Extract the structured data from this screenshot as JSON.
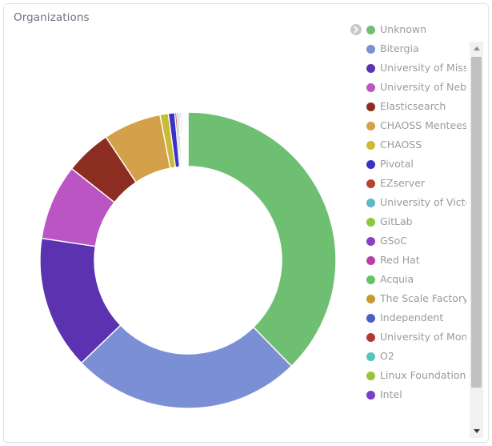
{
  "panel": {
    "title": "Organizations"
  },
  "legend": {
    "cursor_icon": "chevron-right-circle-icon",
    "items": [
      {
        "label": "Unknown",
        "color": "#6fbf73"
      },
      {
        "label": "Bitergia",
        "color": "#7b8fd4"
      },
      {
        "label": "University of Miss...",
        "color": "#5b33b0"
      },
      {
        "label": "University of Nebr...",
        "color": "#bb55c4"
      },
      {
        "label": "Elasticsearch",
        "color": "#8c2d22"
      },
      {
        "label": "CHAOSS Mentees",
        "color": "#d4a04a"
      },
      {
        "label": "CHAOSS",
        "color": "#c9bb36"
      },
      {
        "label": "Pivotal",
        "color": "#3a32c4"
      },
      {
        "label": "EZserver",
        "color": "#b3462f"
      },
      {
        "label": "University of Victoria",
        "color": "#5fb6c4"
      },
      {
        "label": "GitLab",
        "color": "#8dc63f"
      },
      {
        "label": "GSoC",
        "color": "#8a3fc0"
      },
      {
        "label": "Red Hat",
        "color": "#b83fa8"
      },
      {
        "label": "Acquia",
        "color": "#63c463"
      },
      {
        "label": "The Scale Factory",
        "color": "#c8992f"
      },
      {
        "label": "Independent",
        "color": "#4a5fc1"
      },
      {
        "label": "University of Mons",
        "color": "#b03a3a"
      },
      {
        "label": "O2",
        "color": "#55c4bb"
      },
      {
        "label": "Linux Foundation",
        "color": "#9ac43f"
      },
      {
        "label": "Intel",
        "color": "#7a3fc8"
      }
    ]
  },
  "scrollbar": {
    "up_icon": "triangle-up-icon",
    "down_icon": "triangle-down-icon"
  },
  "chart_data": {
    "type": "pie",
    "title": "Organizations",
    "variant": "donut",
    "center": [
      230,
      290
    ],
    "outer_radius": 185,
    "inner_radius": 117,
    "start_angle": 0,
    "legend_position": "right",
    "grid": false,
    "categories": [
      "Unknown",
      "Bitergia",
      "University of Miss...",
      "University of Nebr...",
      "Elasticsearch",
      "CHAOSS Mentees",
      "CHAOSS",
      "Pivotal",
      "EZserver",
      "University of Victoria",
      "GitLab",
      "GSoC",
      "Red Hat",
      "Acquia",
      "The Scale Factory",
      "Independent",
      "University of Mons",
      "O2",
      "Linux Foundation",
      "Intel"
    ],
    "values": [
      37.5,
      25.0,
      14.5,
      8.2,
      5.0,
      6.3,
      0.9,
      0.7,
      0.2,
      0.2,
      0.15,
      0.15,
      0.12,
      0.1,
      0.1,
      0.1,
      0.08,
      0.08,
      0.07,
      0.07
    ],
    "colors": [
      "#6fbf73",
      "#7b8fd4",
      "#5b33b0",
      "#bb55c4",
      "#8c2d22",
      "#d4a04a",
      "#c9bb36",
      "#3a32c4",
      "#b3462f",
      "#5fb6c4",
      "#8dc63f",
      "#8a3fc0",
      "#b83fa8",
      "#63c463",
      "#c8992f",
      "#4a5fc1",
      "#b03a3a",
      "#55c4bb",
      "#9ac43f",
      "#7a3fc8"
    ]
  }
}
